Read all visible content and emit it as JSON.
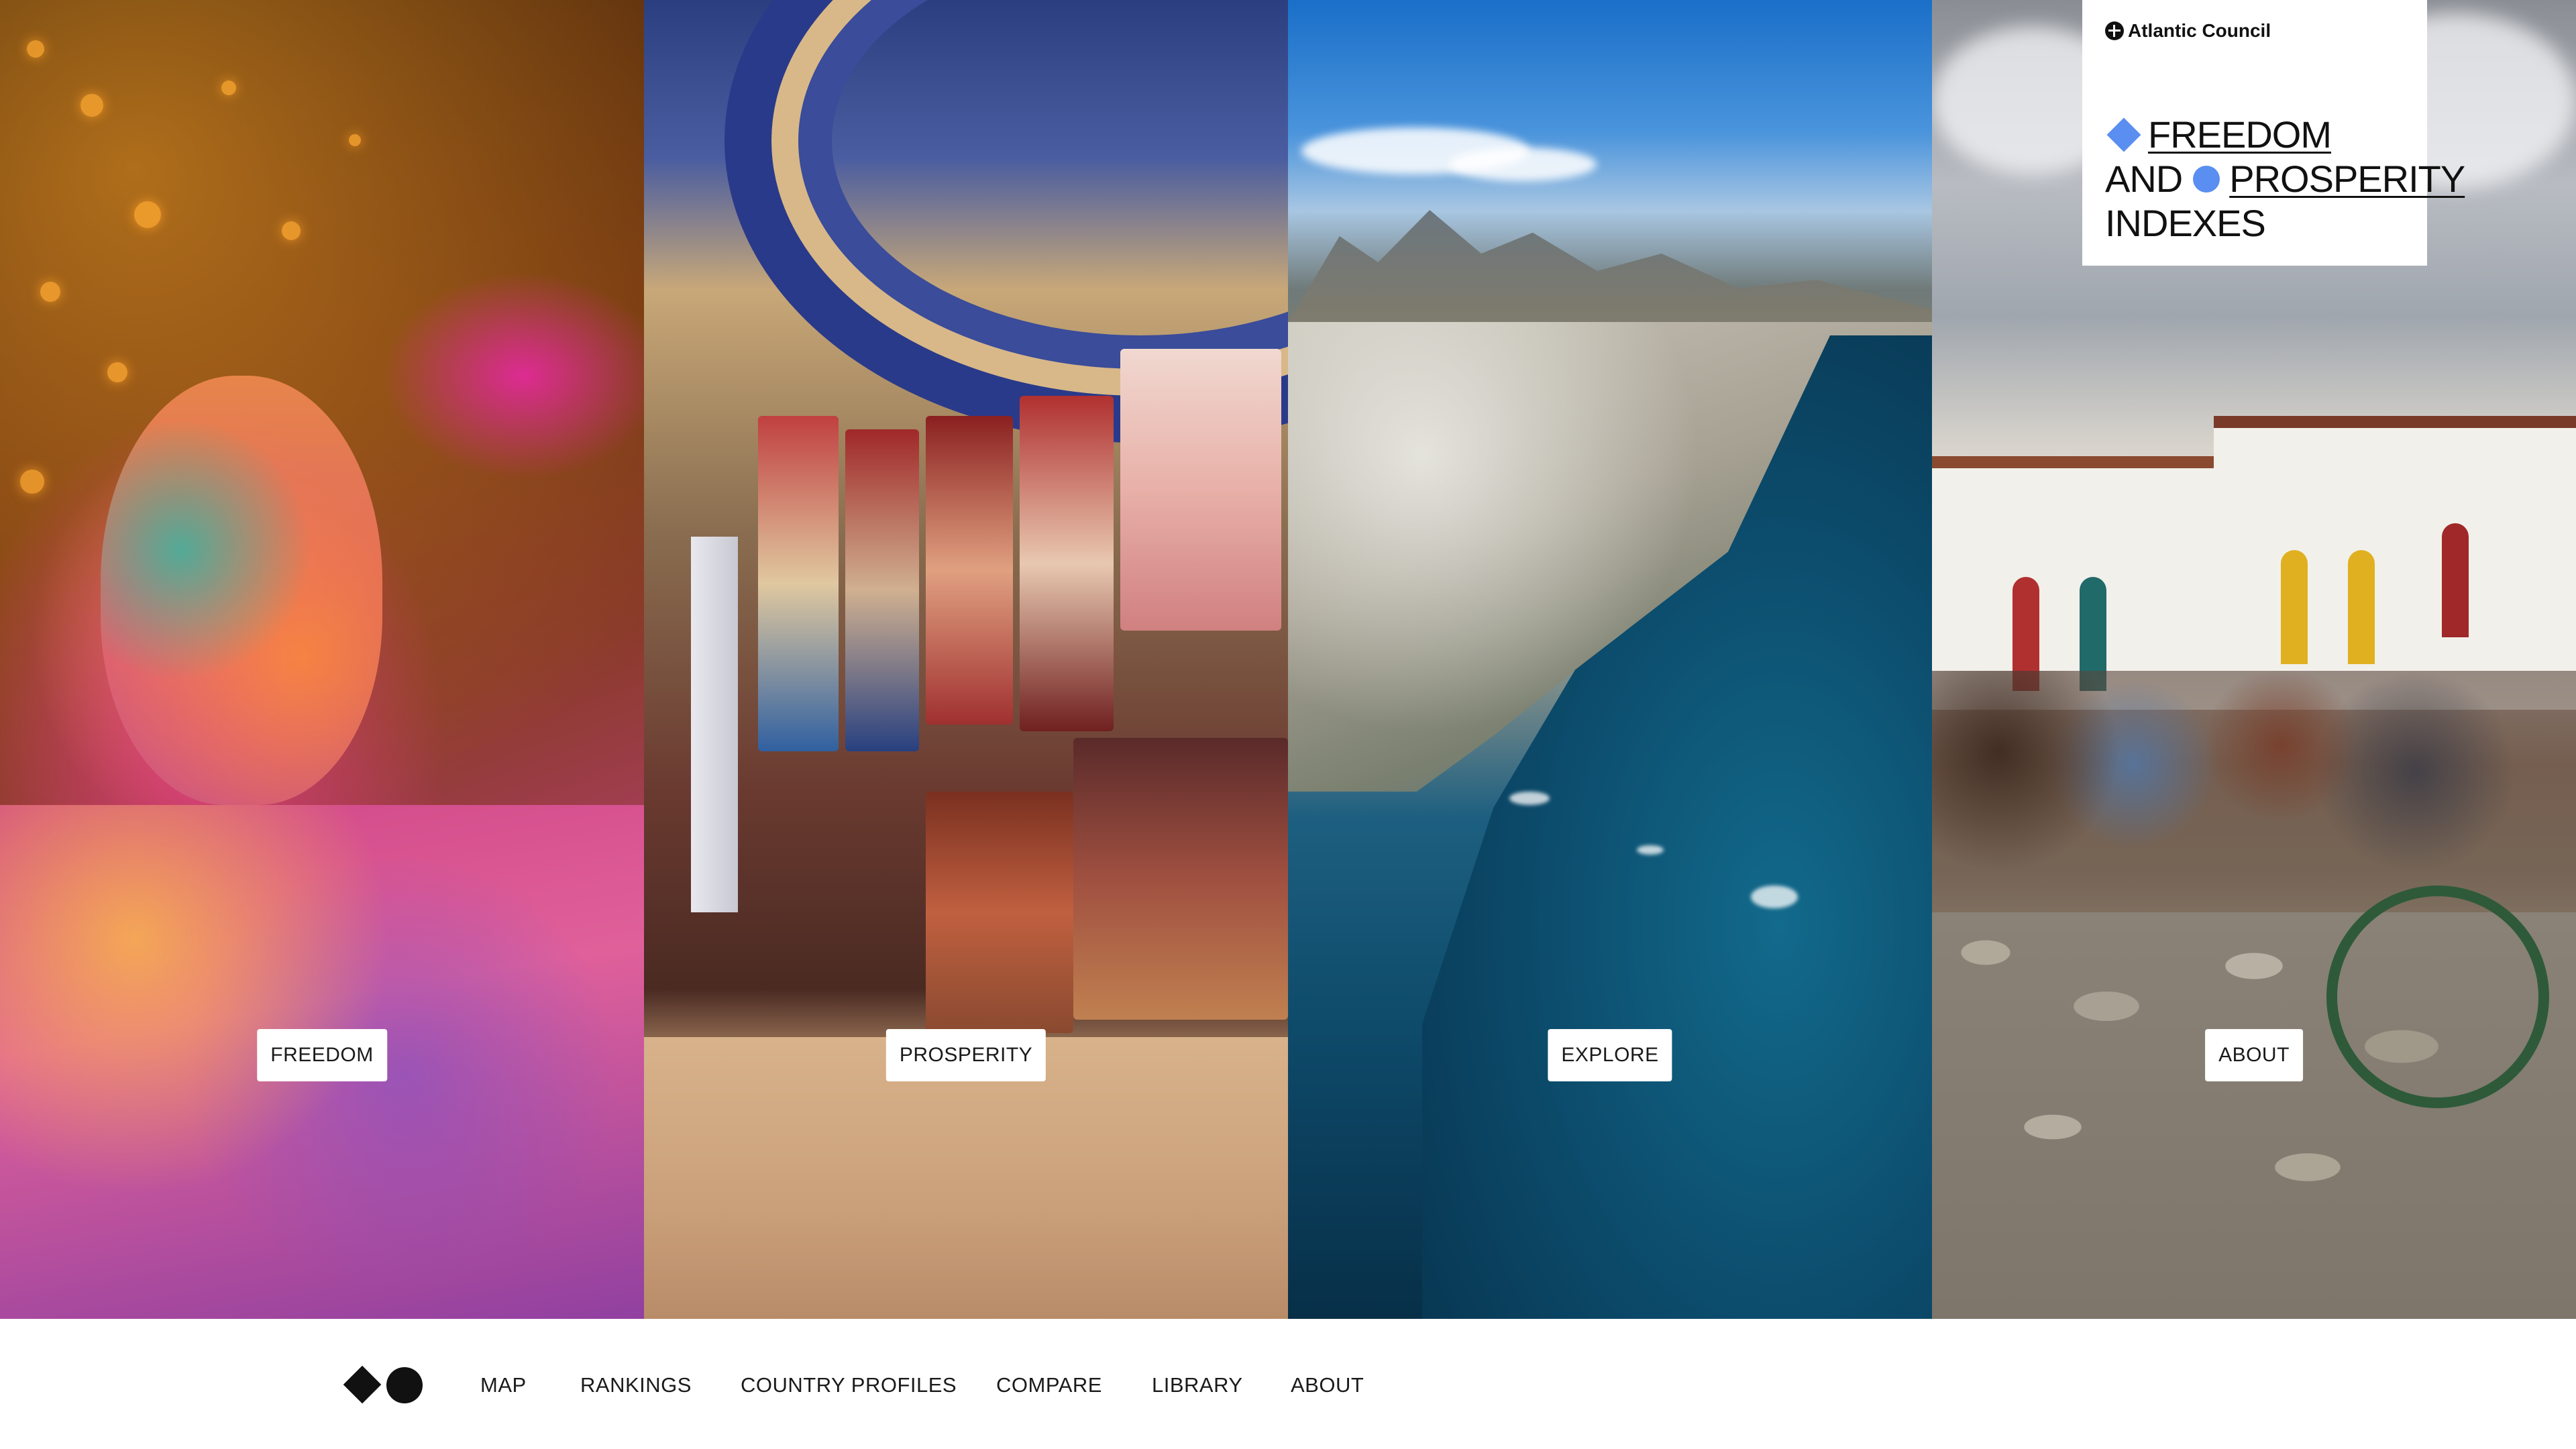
{
  "title_card": {
    "org_name": "Atlantic Council",
    "org_icon": "globe-icon",
    "headline_word1": "FREEDOM",
    "headline_and": "AND",
    "headline_word2": "PROSPERITY",
    "headline_word3": "INDEXES",
    "accent_color": "#5a8ef0"
  },
  "panels": [
    {
      "label": "FREEDOM",
      "image": "woman covered in colorful holi powder"
    },
    {
      "label": "PROSPERITY",
      "image": "bazaar with hanging rugs"
    },
    {
      "label": "EXPLORE",
      "image": "aerial coastal city and ocean"
    },
    {
      "label": "ABOUT",
      "image": "cobblestone street with cafe crowd and cyclist"
    }
  ],
  "nav": {
    "logo": "diamond-circle-logo",
    "items": [
      "MAP",
      "RANKINGS",
      "COUNTRY PROFILES",
      "COMPARE",
      "LIBRARY",
      "ABOUT"
    ]
  }
}
